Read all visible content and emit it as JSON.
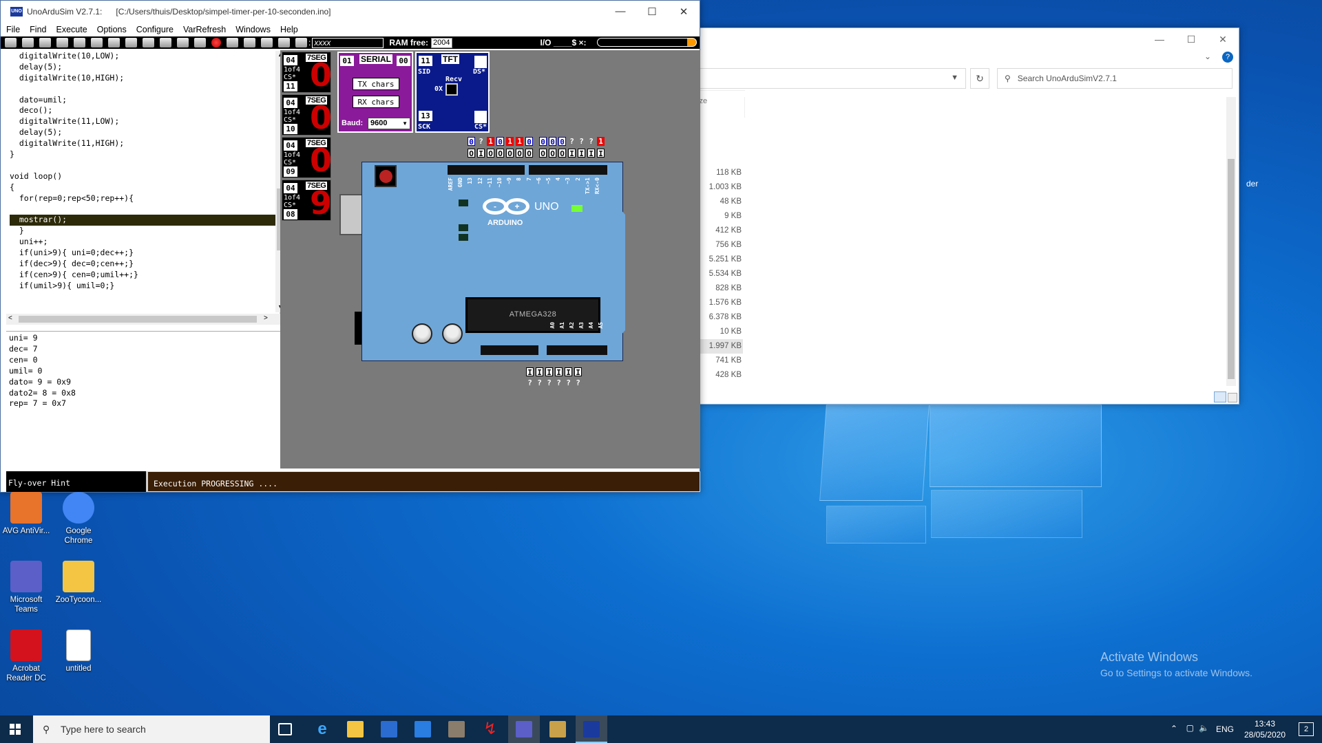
{
  "app": {
    "title": "UnoArduSim V2.7.1:",
    "path": "[C:/Users/thuis/Desktop/simpel-timer-per-10-seconden.ino]",
    "menu": [
      "File",
      "Find",
      "Execute",
      "Options",
      "Configure",
      "VarRefresh",
      "Windows",
      "Help"
    ],
    "toolbar": {
      "find_box": "xxxx",
      "ram_label": "RAM free:",
      "ram_value": "2004",
      "io_label": "I/O ____$ ×:"
    },
    "code_lines": [
      "  digitalWrite(10,LOW);",
      "  delay(5);",
      "  digitalWrite(10,HIGH);",
      "",
      "  dato=umil;",
      "  deco();",
      "  digitalWrite(11,LOW);",
      "  delay(5);",
      "  digitalWrite(11,HIGH);",
      "}",
      "",
      "void loop()",
      "{",
      "  for(rep=0;rep<50;rep++){",
      "",
      "  mostrar();",
      "  }",
      "  uni++;",
      "  if(uni>9){ uni=0;dec++;}",
      "  if(dec>9){ dec=0;cen++;}",
      "  if(cen>9){ cen=0;umil++;}",
      "  if(umil>9){ umil=0;}"
    ],
    "highlight_line": 15,
    "variables": [
      "uni= 9",
      "dec= 7",
      "cen= 0",
      "umil= 0",
      "dato= 9 = 0x9",
      "dato2= 8 = 0x8",
      "rep= 7 = 0x7"
    ],
    "status": {
      "hint": "Fly-over Hint",
      "exec": "Execution PROGRESSING ...."
    }
  },
  "lab": {
    "seg_modules": [
      {
        "top_num": "04",
        "tag": "7SEG",
        "label1": "1of4",
        "label2": "CS*",
        "cs_num": "11",
        "digit": "0"
      },
      {
        "top_num": "04",
        "tag": "7SEG",
        "label1": "1of4",
        "label2": "CS*",
        "cs_num": "10",
        "digit": "0"
      },
      {
        "top_num": "04",
        "tag": "7SEG",
        "label1": "1of4",
        "label2": "CS*",
        "cs_num": "09",
        "digit": "0"
      },
      {
        "top_num": "04",
        "tag": "7SEG",
        "label1": "1of4",
        "label2": "CS*",
        "cs_num": "08",
        "digit": "9"
      }
    ],
    "serial": {
      "left_num": "01",
      "right_num": "00",
      "tag": "SERIAL",
      "tx": "TX chars",
      "rx": "RX chars",
      "baud_label": "Baud:",
      "baud_value": "9600"
    },
    "tft": {
      "top_num": "11",
      "tag": "TFT",
      "sid": "SID",
      "ds": "DS*",
      "recv": "Recv",
      "ox": "0X",
      "bottom_num": "13",
      "sck": "SCK",
      "cs": "CS*"
    },
    "pins_top": [
      "0",
      "?",
      "1",
      "0",
      "1",
      "1",
      "0",
      "0",
      "0",
      "0",
      "?",
      "?",
      "?",
      "1"
    ],
    "pins_io": [
      "O",
      "I",
      "O",
      "O",
      "O",
      "O",
      "O",
      "O",
      "O",
      "O",
      "I",
      "I",
      "I",
      "I"
    ],
    "pins_bottom_io": [
      "I",
      "I",
      "I",
      "I",
      "I",
      "I"
    ],
    "pins_bottom": [
      "?",
      "?",
      "?",
      "?",
      "?",
      "?"
    ],
    "board": {
      "chip": "ATMEGA328",
      "brand": "ARDUINO",
      "model": "UNO",
      "digital_labels": [
        "AREF",
        "GND",
        "13",
        "12",
        "~11",
        "~10",
        "~9",
        "8",
        "7",
        "~6",
        "~5",
        "4",
        "~3",
        "2",
        "TX->1",
        "RX<-0"
      ],
      "analog_labels": [
        "A0",
        "A1",
        "A2",
        "A3",
        "A4",
        "A5"
      ]
    }
  },
  "explorer": {
    "search_placeholder": "Search UnoArduSimV2.7.1",
    "col_fragment": "ize",
    "side_fragment": "der",
    "sizes": [
      "118 KB",
      "1.003 KB",
      "48 KB",
      "9 KB",
      "412 KB",
      "756 KB",
      "5.251 KB",
      "5.534 KB",
      "828 KB",
      "1.576 KB",
      "6.378 KB",
      "10 KB",
      "1.997 KB",
      "741 KB",
      "428 KB"
    ],
    "selected_index": 12
  },
  "desktop": {
    "icons": [
      {
        "label": "AVG AntiVir...",
        "color": "#e8732a"
      },
      {
        "label": "Google Chrome",
        "color": "#4285f4"
      },
      {
        "label": "Microsoft Teams",
        "color": "#5b5fc7"
      },
      {
        "label": "ZooTycoon...",
        "color": "#f3c542"
      },
      {
        "label": "Acrobat Reader DC",
        "color": "#d4121e"
      },
      {
        "label": "untitled",
        "color": "#ffffff"
      }
    ],
    "watermark_title": "Activate Windows",
    "watermark_sub": "Go to Settings to activate Windows."
  },
  "taskbar": {
    "search_placeholder": "Type here to search",
    "lang": "ENG",
    "time": "13:43",
    "date": "28/05/2020",
    "notif_count": "2"
  }
}
